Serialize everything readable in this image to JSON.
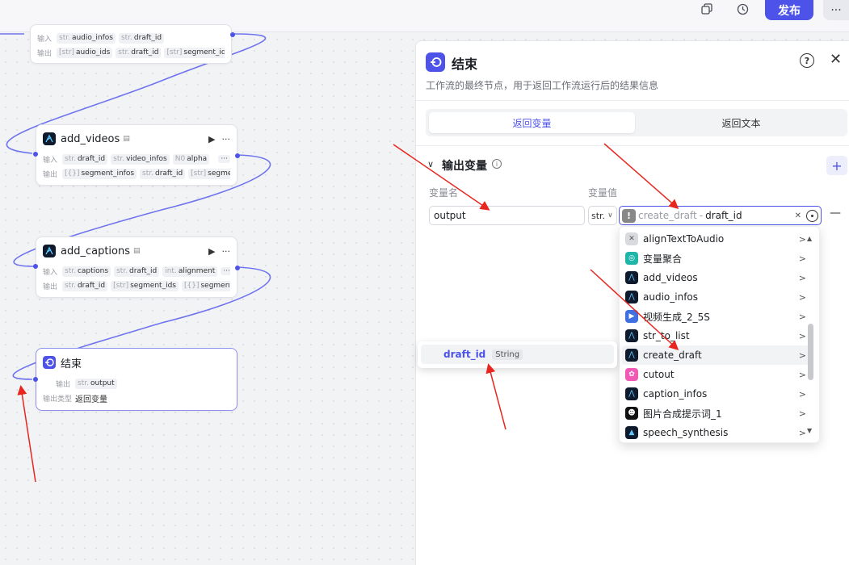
{
  "topbar": {
    "publish_label": "发布",
    "more_label": "···"
  },
  "canvas": {
    "node_top": {
      "in_label": "输入",
      "inputs": [
        {
          "type": "str.",
          "name": "audio_infos"
        },
        {
          "type": "str.",
          "name": "draft_id"
        }
      ],
      "out_label": "输出",
      "outputs": [
        {
          "type": "[str]",
          "name": "audio_ids"
        },
        {
          "type": "str.",
          "name": "draft_id"
        },
        {
          "type": "[str]",
          "name": "segment_ids"
        }
      ],
      "more": "···"
    },
    "node_videos": {
      "title": "add_videos",
      "in_label": "输入",
      "inputs": [
        {
          "type": "str.",
          "name": "draft_id"
        },
        {
          "type": "str.",
          "name": "video_infos"
        },
        {
          "type": "N0",
          "name": "alpha"
        }
      ],
      "out_label": "输出",
      "outputs": [
        {
          "type": "[{}]",
          "name": "segment_infos"
        },
        {
          "type": "str.",
          "name": "draft_id"
        },
        {
          "type": "[str]",
          "name": "segment_ids"
        }
      ],
      "more": "···"
    },
    "node_captions": {
      "title": "add_captions",
      "in_label": "输入",
      "inputs": [
        {
          "type": "str.",
          "name": "captions"
        },
        {
          "type": "str.",
          "name": "draft_id"
        },
        {
          "type": "int.",
          "name": "alignment"
        }
      ],
      "out_label": "输出",
      "outputs": [
        {
          "type": "str.",
          "name": "draft_id"
        },
        {
          "type": "[str]",
          "name": "segment_ids"
        },
        {
          "type": "[{}]",
          "name": "segment_infos"
        }
      ],
      "more": "···"
    },
    "node_end": {
      "title": "结束",
      "out_label": "输出",
      "output": {
        "type": "str.",
        "name": "output"
      },
      "out_type_label": "输出类型",
      "out_type_value": "返回变量"
    }
  },
  "panel": {
    "title": "结束",
    "description": "工作流的最终节点，用于返回工作流运行后的结果信息",
    "tabs": [
      "返回变量",
      "返回文本"
    ],
    "section_title": "输出变量",
    "col_name": "变量名",
    "col_value": "变量值",
    "var_name_value": "output",
    "type_value": "str.",
    "selected_node": "create_draft",
    "selected_sep": "-",
    "selected_var": "draft_id"
  },
  "dropdown": {
    "items": [
      {
        "label": "alignTextToAudio",
        "color": "#d9dadd"
      },
      {
        "label": "变量聚合",
        "color": "#1fb5a8"
      },
      {
        "label": "add_videos",
        "color": "#0f1a2d"
      },
      {
        "label": "audio_infos",
        "color": "#0f1a2d"
      },
      {
        "label": "视频生成_2_5S",
        "color": "#3f6fe0"
      },
      {
        "label": "str_to_list",
        "color": "#0f1a2d"
      },
      {
        "label": "create_draft",
        "color": "#0f1a2d"
      },
      {
        "label": "cutout",
        "color": "#f05ab4"
      },
      {
        "label": "caption_infos",
        "color": "#0f1a2d"
      },
      {
        "label": "图片合成提示词_1",
        "color": "#111111"
      },
      {
        "label": "speech_synthesis",
        "color": "#0f1a2d"
      }
    ]
  },
  "submenu": {
    "var_name": "draft_id",
    "var_type": "String"
  },
  "colors": {
    "accent": "#4d53e8",
    "annotation": "#e8261f"
  }
}
